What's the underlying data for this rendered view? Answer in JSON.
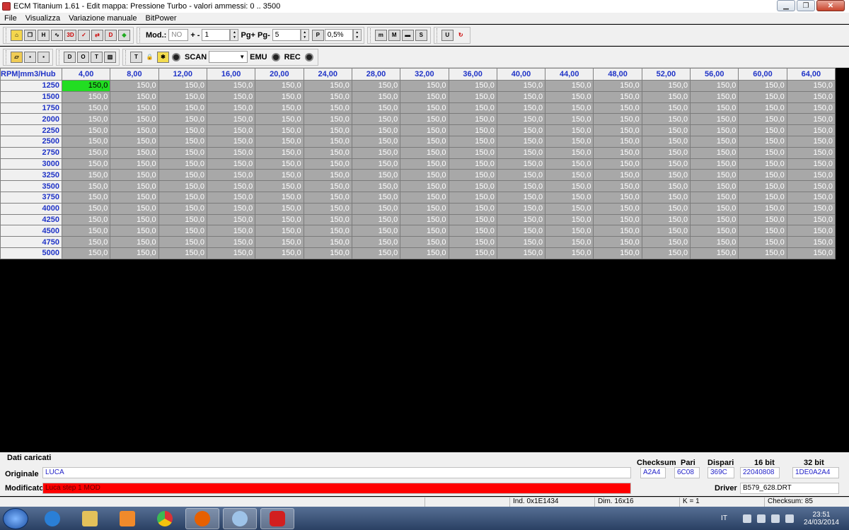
{
  "window": {
    "title": "ECM Titanium 1.61 - Edit mappa: Pressione Turbo - valori ammessi: 0 .. 3500"
  },
  "menu": [
    "File",
    "Visualizza",
    "Variazione manuale",
    "BitPower"
  ],
  "toolbar1": {
    "mod_label": "Mod.:",
    "mod_value": "NO",
    "step_label": "+ -",
    "step_value": "1",
    "pg_label": "Pg+ Pg-",
    "pg_value": "5",
    "pct_value": "0,5%"
  },
  "toolbar2": {
    "scan_label": "SCAN",
    "emu_label": "EMU",
    "rec_label": "REC"
  },
  "grid": {
    "corner": "RPM|mm3/Hub",
    "columns": [
      "4,00",
      "8,00",
      "12,00",
      "16,00",
      "20,00",
      "24,00",
      "28,00",
      "32,00",
      "36,00",
      "40,00",
      "44,00",
      "48,00",
      "52,00",
      "56,00",
      "60,00",
      "64,00"
    ],
    "rows": [
      "1250",
      "1500",
      "1750",
      "2000",
      "2250",
      "2500",
      "2750",
      "3000",
      "3250",
      "3500",
      "3750",
      "4000",
      "4250",
      "4500",
      "4750",
      "5000"
    ],
    "cell_value": "150,0",
    "selected_color": "#22dd22"
  },
  "bottom": {
    "title": "Dati caricati",
    "originale_label": "Originale",
    "originale_value": "LUCA",
    "modificato_label": "Modificato",
    "modificato_value": "Luca step 1 MOD",
    "checksum_label": "Checksum",
    "checksum_value": "A2A4",
    "pari_label": "Pari",
    "pari_value": "6C08",
    "dispari_label": "Dispari",
    "dispari_value": "369C",
    "bit16_label": "16 bit",
    "bit16_value": "22040808",
    "bit32_label": "32 bit",
    "bit32_value": "1DE0A2A4",
    "driver_label": "Driver",
    "driver_value": "B579_628.DRT"
  },
  "status": {
    "ind": "Ind. 0x1E1434",
    "dim": "Dim. 16x16",
    "k": "K = 1",
    "checksum": "Checksum: 85"
  },
  "taskbar": {
    "lang": "IT",
    "time": "23:51",
    "date": "24/03/2014"
  }
}
